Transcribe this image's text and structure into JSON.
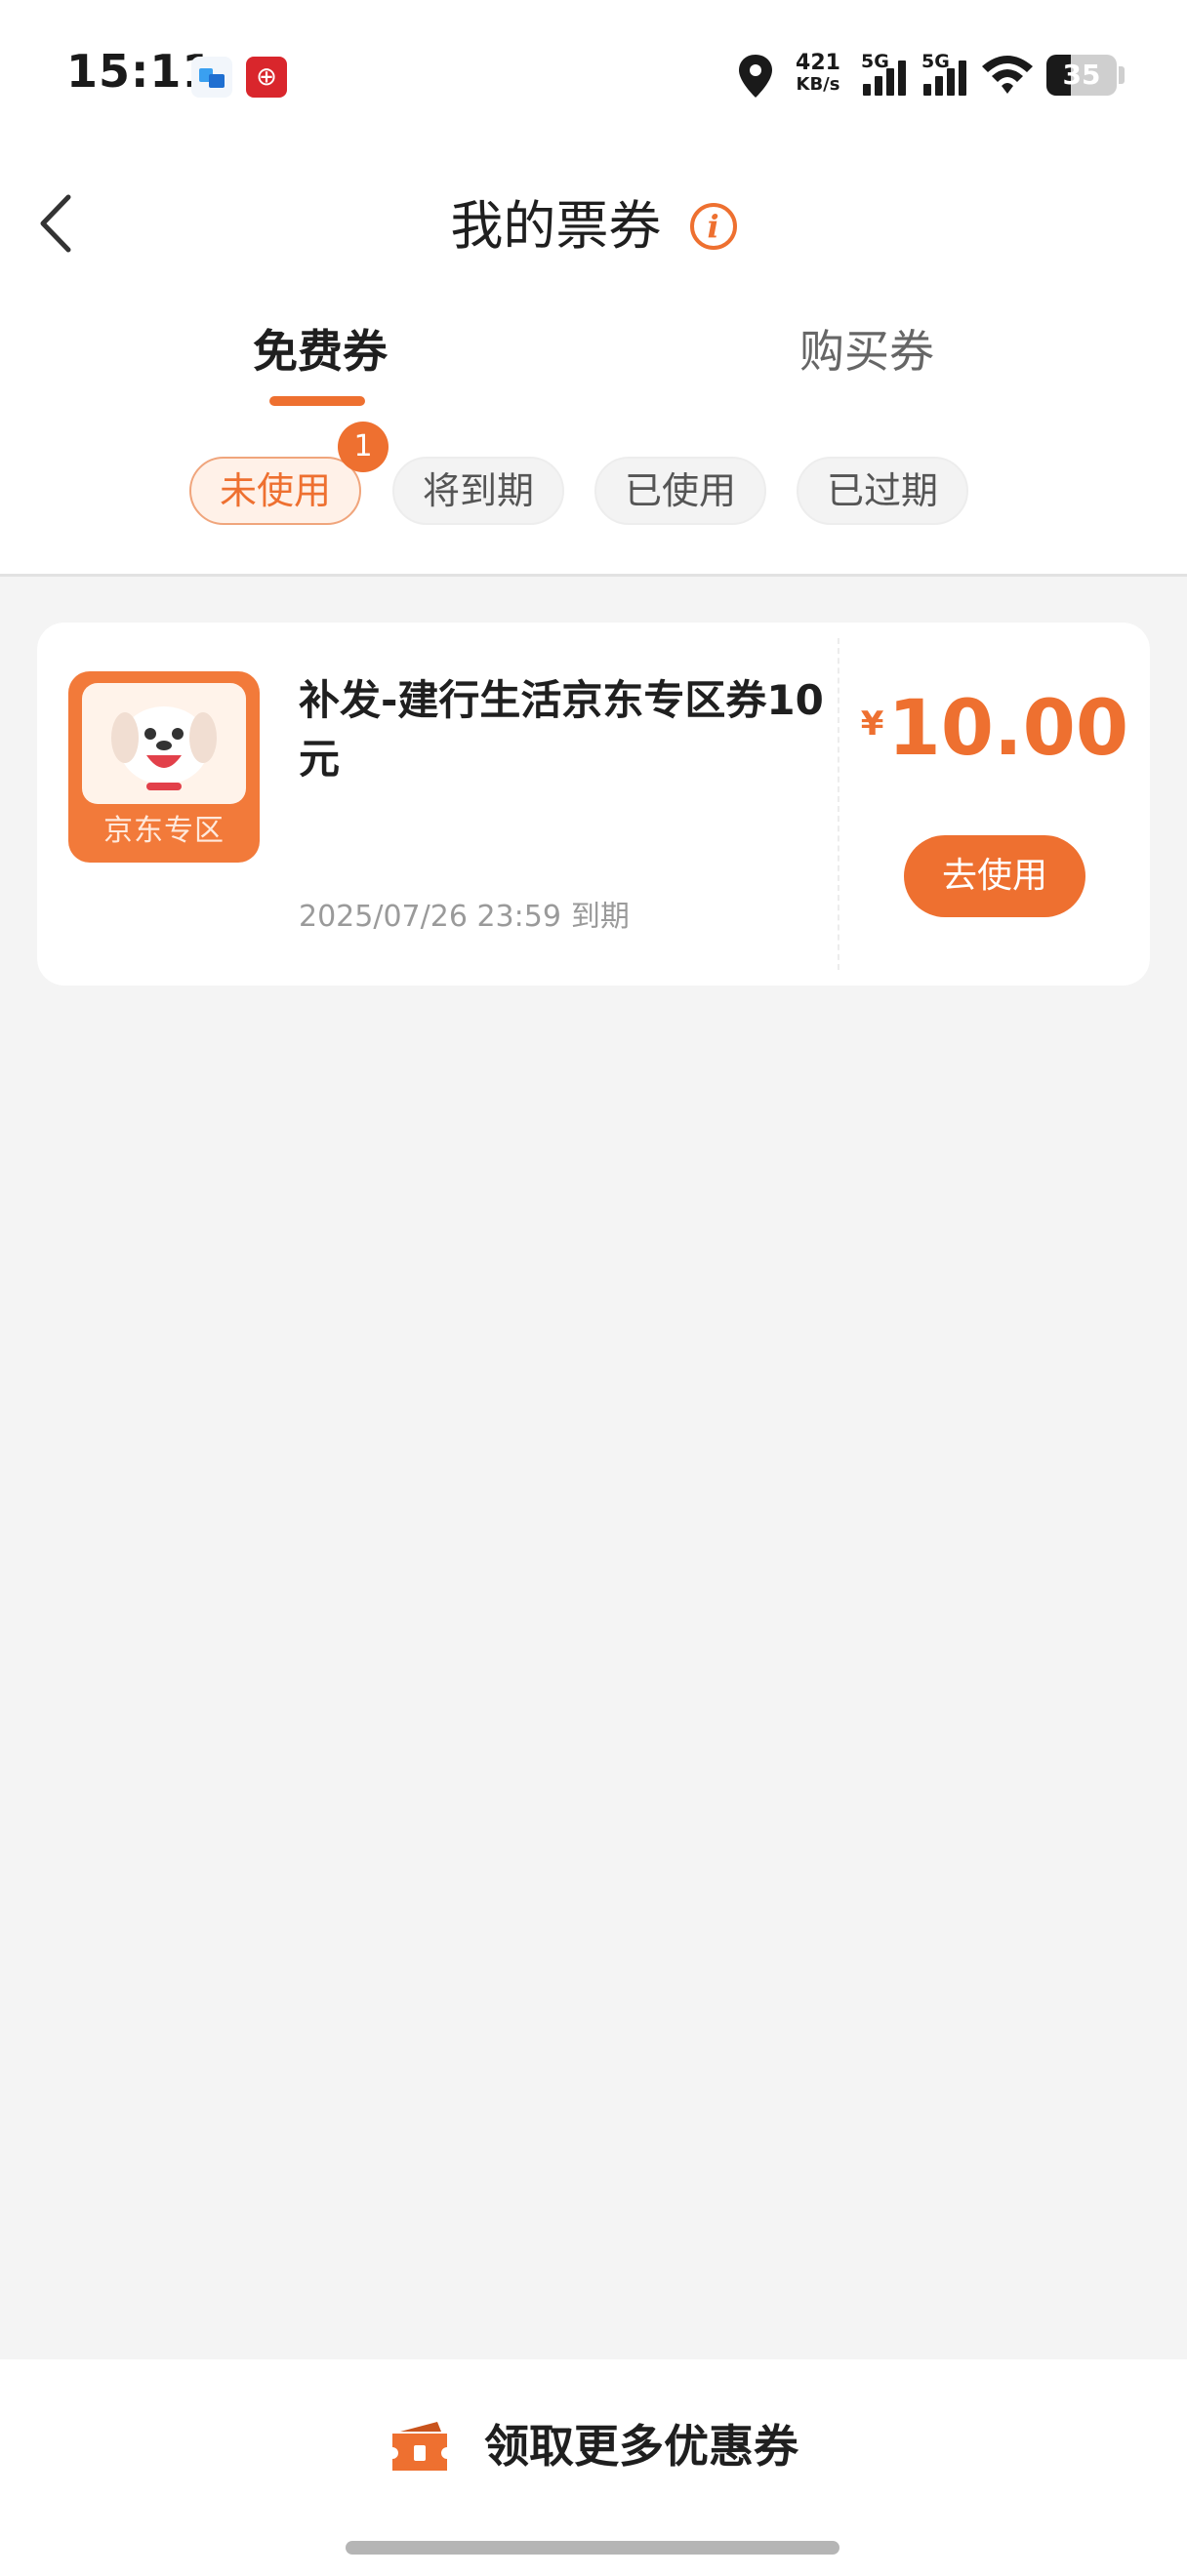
{
  "status_bar": {
    "time": "15:11",
    "net_speed_value": "421",
    "net_speed_unit": "KB/s",
    "signal_1_label": "5G",
    "signal_2_label": "5G",
    "battery_level": "35",
    "icons": [
      "app-notification-icon",
      "bank-app-icon",
      "location-icon",
      "signal-icon",
      "wifi-icon",
      "battery-icon"
    ]
  },
  "header": {
    "title": "我的票券",
    "back_icon": "chevron-left-icon",
    "info_icon": "info-icon",
    "info_glyph": "i"
  },
  "tabs": [
    {
      "label": "免费券",
      "active": true
    },
    {
      "label": "购买券",
      "active": false
    }
  ],
  "filters": {
    "items": [
      {
        "label": "未使用",
        "active": true
      },
      {
        "label": "将到期",
        "active": false
      },
      {
        "label": "已使用",
        "active": false
      },
      {
        "label": "已过期",
        "active": false
      }
    ],
    "badge_count": "1"
  },
  "coupons": [
    {
      "title": "补发-建行生活京东专区券10元",
      "logo_text": "京东专区",
      "expiry_date": "2025/07/26 23:59",
      "expiry_suffix": "到期",
      "currency": "¥",
      "amount": "10.00",
      "action_label": "去使用"
    }
  ],
  "footer": {
    "more_label": "领取更多优惠券",
    "icon": "ticket-icon"
  },
  "colors": {
    "accent": "#ee7030",
    "background": "#f4f4f4",
    "card": "#ffffff"
  }
}
